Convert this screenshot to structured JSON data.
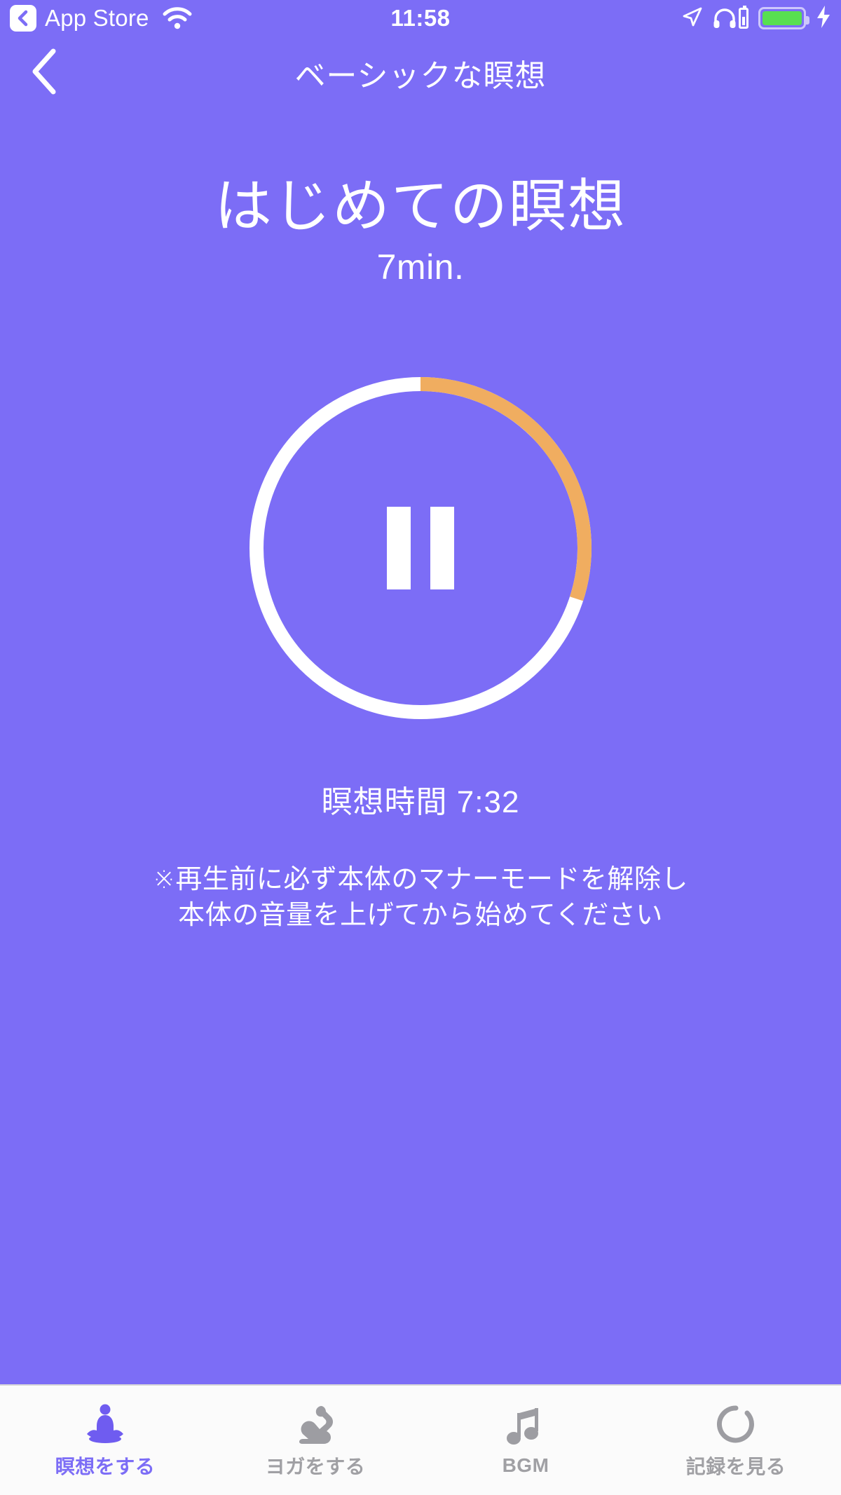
{
  "theme": {
    "background_purple": "#7c6df6",
    "progress_orange": "#f0ad60",
    "progress_track_white": "#ffffff",
    "tabbar_background": "#fbfbfb",
    "tab_active_color": "#7c6df6",
    "tab_inactive_color": "#a0a0a4",
    "battery_green": "#58df51"
  },
  "status_bar": {
    "back_app_label": "App Store",
    "back_icon": "chevron-left-icon",
    "wifi_icon": "wifi-icon",
    "clock": "11:58",
    "location_icon": "location-arrow-icon",
    "headphones_icon": "headphones-icon",
    "headphones_battery_icon": "headphone-battery-icon",
    "battery_icon": "battery-icon",
    "charging_icon": "lightning-bolt-icon"
  },
  "nav": {
    "back_icon": "chevron-left-icon",
    "title": "ベーシックな瞑想"
  },
  "session": {
    "title": "はじめての瞑想",
    "duration_label": "7min.",
    "elapsed_label": "瞑想時間 7:32",
    "player_state": "playing",
    "player_icon": "pause-icon",
    "notice_line1": "※再生前に必ず本体のマナーモードを解除し",
    "notice_line2": "本体の音量を上げてから始めてください"
  },
  "progress_ring": {
    "total_minutes": 7,
    "elapsed_time": "7:32",
    "sweep_degrees": 108,
    "percent": 30,
    "track_color": "#ffffff",
    "arc_color": "#f0ad60",
    "stroke_width": 20,
    "radius": 234
  },
  "tabs": [
    {
      "label": "瞑想をする",
      "icon": "meditation-lotus-icon",
      "active": true
    },
    {
      "label": "ヨガをする",
      "icon": "yoga-pose-icon",
      "active": false
    },
    {
      "label": "BGM",
      "icon": "music-note-icon",
      "active": false
    },
    {
      "label": "記録を見る",
      "icon": "circular-arc-history-icon",
      "active": false
    }
  ]
}
